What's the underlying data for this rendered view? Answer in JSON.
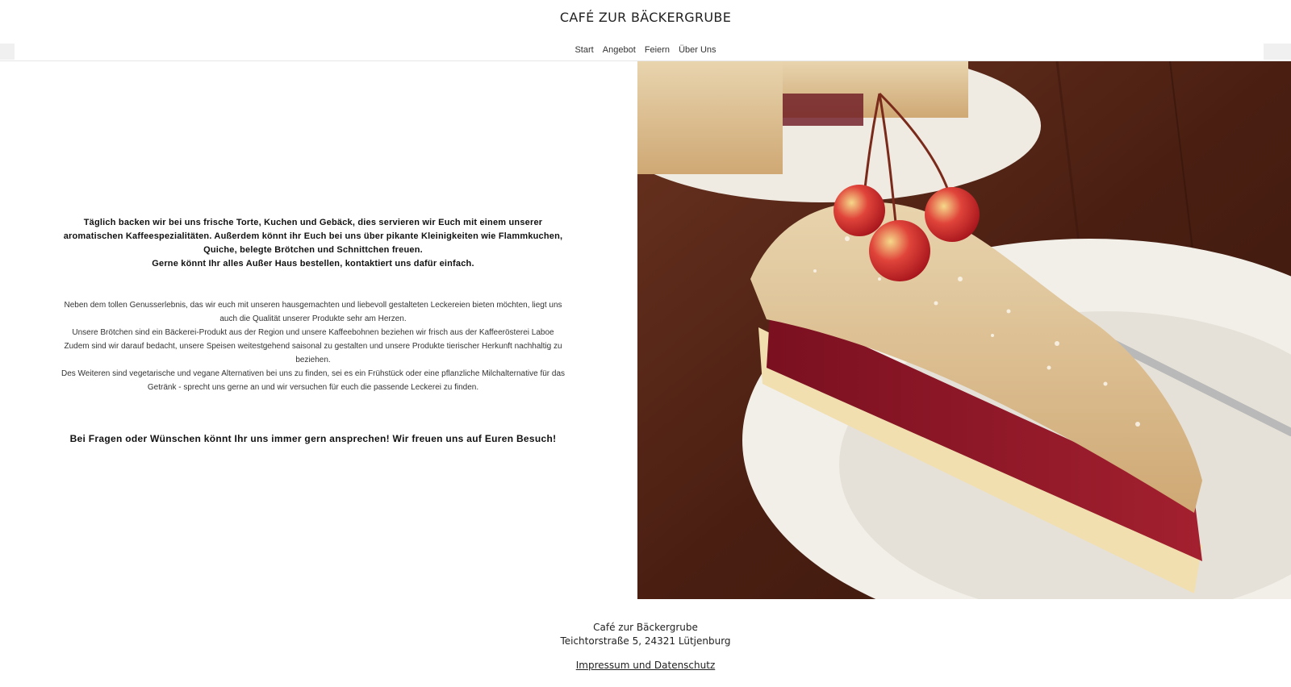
{
  "header": {
    "title": "CAFÉ ZUR BÄCKERGRUBE"
  },
  "nav": {
    "items": [
      "Start",
      "Angebot",
      "Feiern",
      "Über Uns"
    ]
  },
  "main": {
    "intro_lines": [
      "Täglich backen wir bei uns frische Torte, Kuchen und Gebäck, dies servieren wir Euch mit einem unserer aromatischen Kaffeespezialitäten. Außerdem könnt ihr Euch bei uns über pikante Kleinigkeiten wie Flammkuchen, Quiche, belegte Brötchen und Schnittchen freuen.",
      "Gerne könnt Ihr alles Außer Haus bestellen, kontaktiert uns dafür einfach."
    ],
    "detail_lines": [
      "Neben dem tollen Genusserlebnis, das wir euch mit unseren hausgemachten und liebevoll gestalteten Leckereien bieten möchten, liegt uns auch die Qualität unserer Produkte sehr am Herzen.",
      "Unsere Brötchen sind ein Bäckerei-Produkt aus der Region und unsere Kaffeebohnen beziehen wir frisch aus der Kaffeerösterei Laboe",
      "Zudem sind wir darauf bedacht, unsere Speisen weitestgehend saisonal zu gestalten und unsere Produkte tierischer Herkunft nachhaltig zu beziehen.",
      "Des Weiteren sind vegetarische und vegane Alternativen bei uns zu finden, sei es ein Frühstück oder eine pflanzliche Milchalternative für das Getränk - sprecht uns gerne an und wir versuchen für euch die passende Leckerei zu finden."
    ],
    "closing": "Bei Fragen oder Wünschen könnt Ihr uns immer gern ansprechen! Wir freuen uns auf Euren Besuch!"
  },
  "photo": {
    "subject": "cherry-crumble-cake-slice"
  },
  "footer": {
    "name": "Café zur Bäckergrube",
    "address": "Teichtorstraße 5, 24321 Lütjenburg",
    "legal_link": "Impressum und Datenschutz"
  }
}
